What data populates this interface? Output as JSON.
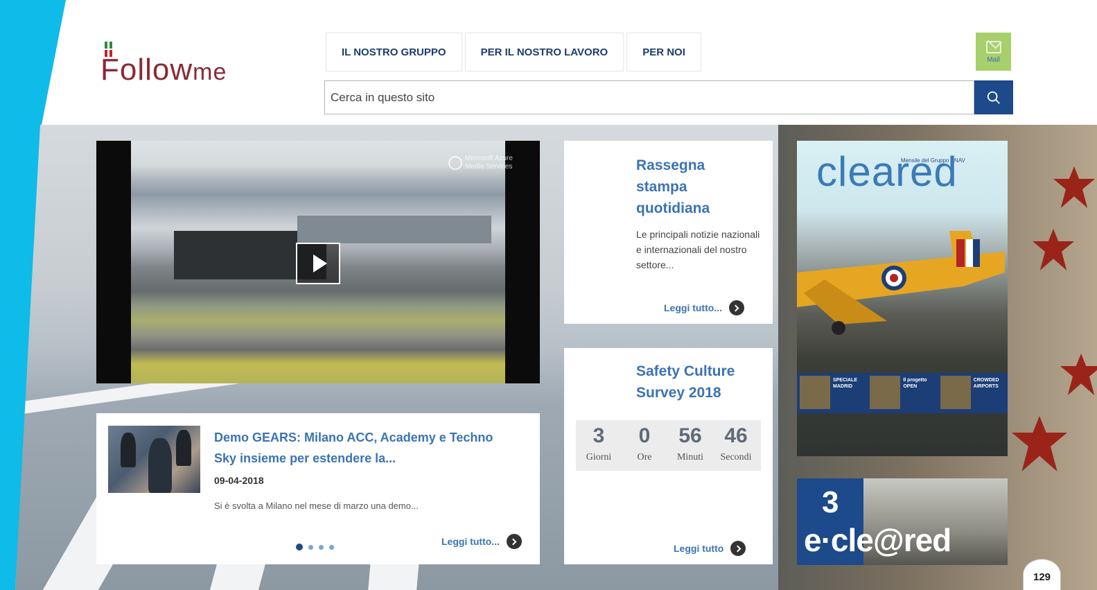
{
  "logo": {
    "text_main": "Follow",
    "text_sub": "me"
  },
  "nav": {
    "items": [
      {
        "label": "IL NOSTRO GRUPPO"
      },
      {
        "label": "PER IL NOSTRO LAVORO"
      },
      {
        "label": "PER NOI"
      }
    ],
    "mail_label": "Mail"
  },
  "search": {
    "placeholder": "Cerca in questo sito"
  },
  "video": {
    "watermark": "Microsoft Azure Media Services"
  },
  "news": {
    "title": "Demo GEARS: Milano ACC, Academy e Techno Sky insieme per estendere la...",
    "date": "09-04-2018",
    "excerpt": "Si è svolta a Milano nel mese di marzo una demo...",
    "read_more": "Leggi tutto...",
    "slides": 4,
    "active_slide": 1
  },
  "press": {
    "title": "Rassegna stampa quotidiana",
    "text": "Le principali notizie nazionali e internazionali del nostro settore...",
    "read_more": "Leggi tutto..."
  },
  "survey": {
    "title": "Safety Culture Survey 2018",
    "countdown": [
      {
        "value": "3",
        "label": "Giorni"
      },
      {
        "value": "0",
        "label": "Ore"
      },
      {
        "value": "56",
        "label": "Minuti"
      },
      {
        "value": "46",
        "label": "Secondi"
      }
    ],
    "read_more": "Leggi tutto"
  },
  "magazine": {
    "masthead": "cleared",
    "tagline": "Mensile del Gruppo ENAV",
    "strip": [
      "SPECIALE MADRID",
      "Il progetto OPEN",
      "CROWDED AIRPORTS"
    ]
  },
  "eclared": {
    "number": "3",
    "logo": "e·cle@red"
  },
  "page_number": "129",
  "colors": {
    "accent": "#3b73b3",
    "navy": "#1c4a8a",
    "mail_green": "#a8cf6c",
    "frame_cyan": "#0fbbe8"
  }
}
